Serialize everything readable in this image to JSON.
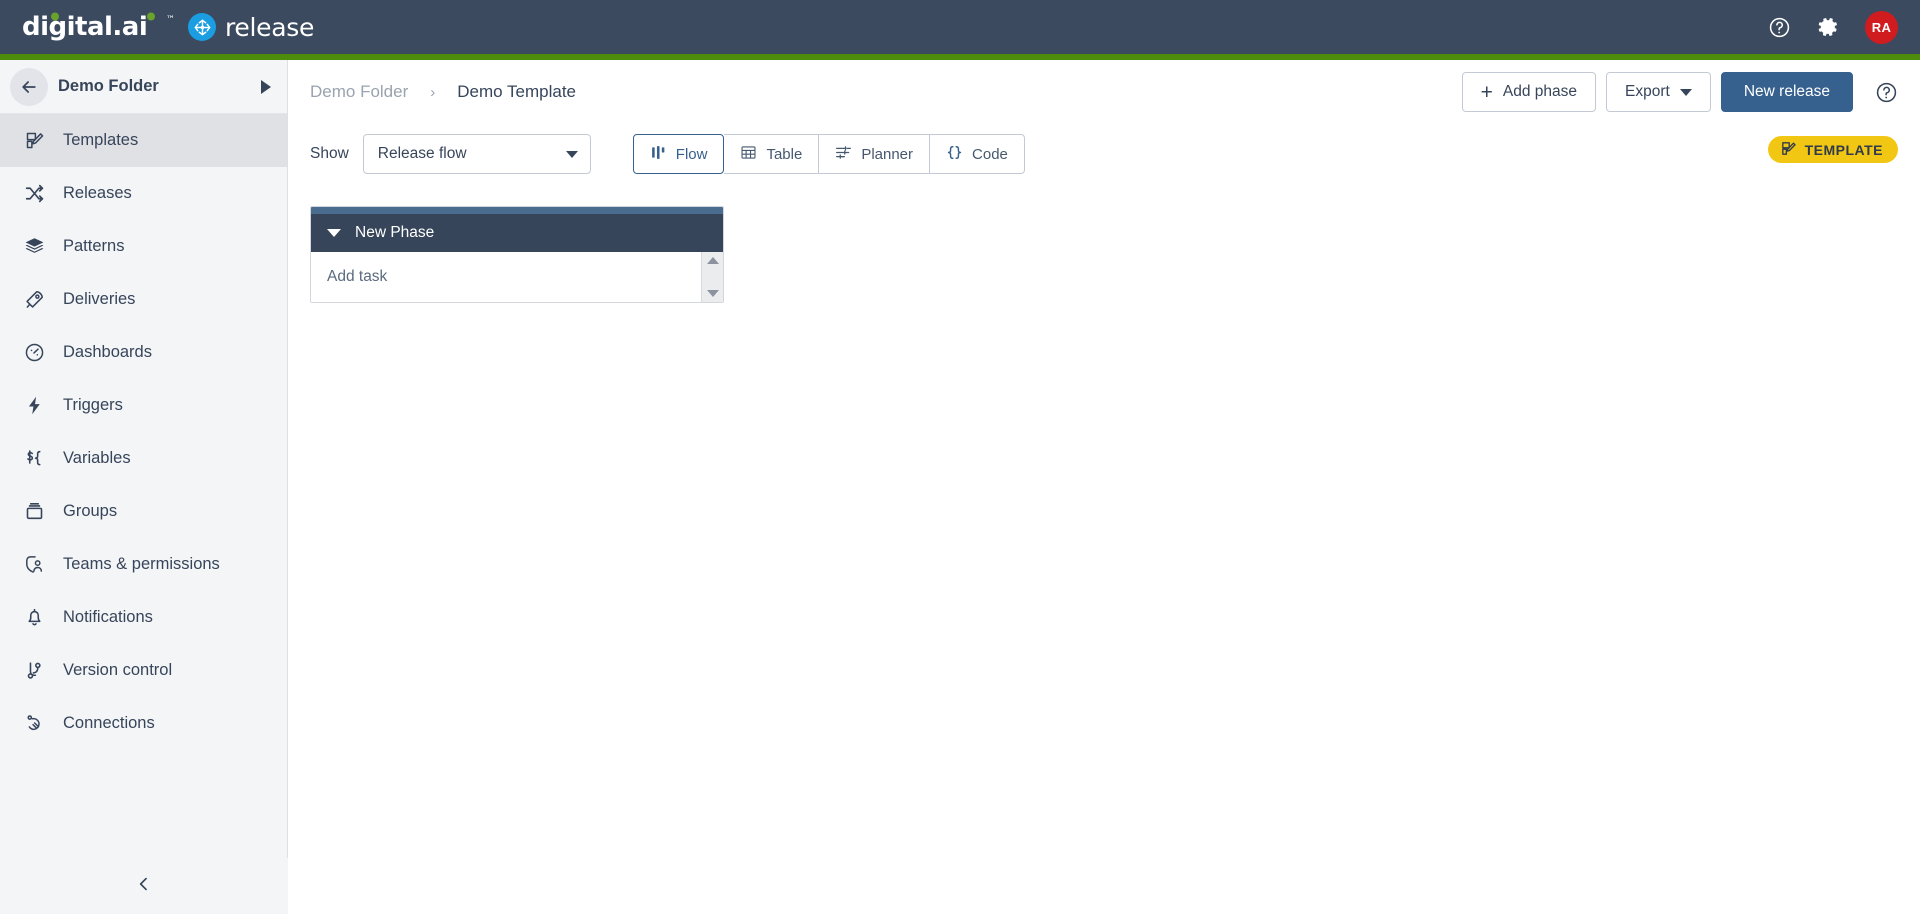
{
  "topbar": {
    "brand_primary": "digital.ai",
    "brand_secondary": "release",
    "help_icon": "help-circle-icon",
    "settings_icon": "gear-icon",
    "avatar_initials": "RA",
    "accent_green": "#4e8c0b",
    "background": "#3b4a5e",
    "avatar_color": "#d01c1f"
  },
  "sidebar": {
    "folder_name": "Demo Folder",
    "back_icon": "arrow-left-icon",
    "expand_icon": "triangle-right-icon",
    "collapse_icon": "chevron-left-icon",
    "items": [
      {
        "label": "Templates",
        "icon": "template-icon",
        "active": true
      },
      {
        "label": "Releases",
        "icon": "shuffle-icon",
        "active": false
      },
      {
        "label": "Patterns",
        "icon": "layers-icon",
        "active": false
      },
      {
        "label": "Deliveries",
        "icon": "rocket-icon",
        "active": false
      },
      {
        "label": "Dashboards",
        "icon": "gauge-icon",
        "active": false
      },
      {
        "label": "Triggers",
        "icon": "lightning-bolt-icon",
        "active": false
      },
      {
        "label": "Variables",
        "icon": "dollar-brace-icon",
        "active": false
      },
      {
        "label": "Groups",
        "icon": "archive-box-icon",
        "active": false
      },
      {
        "label": "Teams & permissions",
        "icon": "shield-person-icon",
        "active": false
      },
      {
        "label": "Notifications",
        "icon": "bell-icon",
        "active": false
      },
      {
        "label": "Version control",
        "icon": "git-branch-icon",
        "active": false
      },
      {
        "label": "Connections",
        "icon": "plug-icon",
        "active": false
      }
    ]
  },
  "main": {
    "breadcrumb": {
      "parent": "Demo Folder",
      "separator": "›",
      "current": "Demo Template"
    },
    "actions": {
      "add_phase_label": "Add phase",
      "add_phase_icon": "plus-icon",
      "export_label": "Export",
      "export_caret_icon": "caret-down-icon",
      "new_release_label": "New release",
      "help_icon": "help-circle-icon",
      "primary_color": "#36618e"
    },
    "toolbar": {
      "show_label": "Show",
      "select_value": "Release flow",
      "select_caret_icon": "caret-down-icon",
      "tabs": [
        {
          "label": "Flow",
          "icon": "bars-icon",
          "active": true
        },
        {
          "label": "Table",
          "icon": "grid-table-icon",
          "active": false
        },
        {
          "label": "Planner",
          "icon": "planner-sliders-icon",
          "active": false
        },
        {
          "label": "Code",
          "icon": "curly-braces-icon",
          "active": false
        }
      ],
      "badge": {
        "label": "TEMPLATE",
        "icon": "template-icon",
        "color": "#f2c714"
      }
    },
    "flow": {
      "phases": [
        {
          "title": "New Phase",
          "collapse_icon": "chevron-down-icon",
          "add_task_label": "Add task",
          "scroll_up_icon": "triangle-up-icon",
          "scroll_down_icon": "triangle-down-icon",
          "header_color": "#37455a",
          "strip_color": "#4a6c8f"
        }
      ]
    }
  }
}
